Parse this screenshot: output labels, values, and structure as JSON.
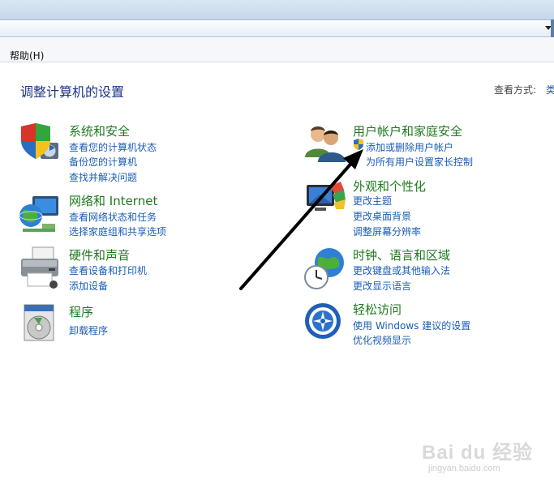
{
  "menu": {
    "help": "帮助(H)"
  },
  "page": {
    "title": "调整计算机的设置",
    "view_by_label": "查看方式:",
    "view_by_value": "类"
  },
  "categories": [
    {
      "title": "系统和安全",
      "icon": "shield-computer-icon",
      "links": [
        "查看您的计算机状态",
        "备份您的计算机",
        "查找并解决问题"
      ]
    },
    {
      "title": "网络和 Internet",
      "icon": "network-globe-icon",
      "links": [
        "查看网络状态和任务",
        "选择家庭组和共享选项"
      ]
    },
    {
      "title": "硬件和声音",
      "icon": "printer-icon",
      "links": [
        "查看设备和打印机",
        "添加设备"
      ]
    },
    {
      "title": "程序",
      "icon": "programs-disc-icon",
      "links": [
        "卸载程序"
      ]
    },
    {
      "title": "用户帐户和家庭安全",
      "icon": "users-icon",
      "links": [
        "添加或删除用户帐户",
        "为所有用户设置家长控制"
      ]
    },
    {
      "title": "外观和个性化",
      "icon": "appearance-monitor-icon",
      "links": [
        "更改主题",
        "更改桌面背景",
        "调整屏幕分辨率"
      ]
    },
    {
      "title": "时钟、语言和区域",
      "icon": "clock-globe-icon",
      "links": [
        "更改键盘或其他输入法",
        "更改显示语言"
      ]
    },
    {
      "title": "轻松访问",
      "icon": "ease-of-access-icon",
      "links": [
        "使用 Windows 建议的设置",
        "优化视频显示"
      ]
    }
  ],
  "watermark": {
    "brand": "Bai du 经验",
    "url": "jingyan.baidu.com"
  },
  "colors": {
    "title_blue": "#1e3287",
    "category_green": "#1e7a1e",
    "link_blue": "#1a5db5",
    "arrow": "#000000"
  }
}
